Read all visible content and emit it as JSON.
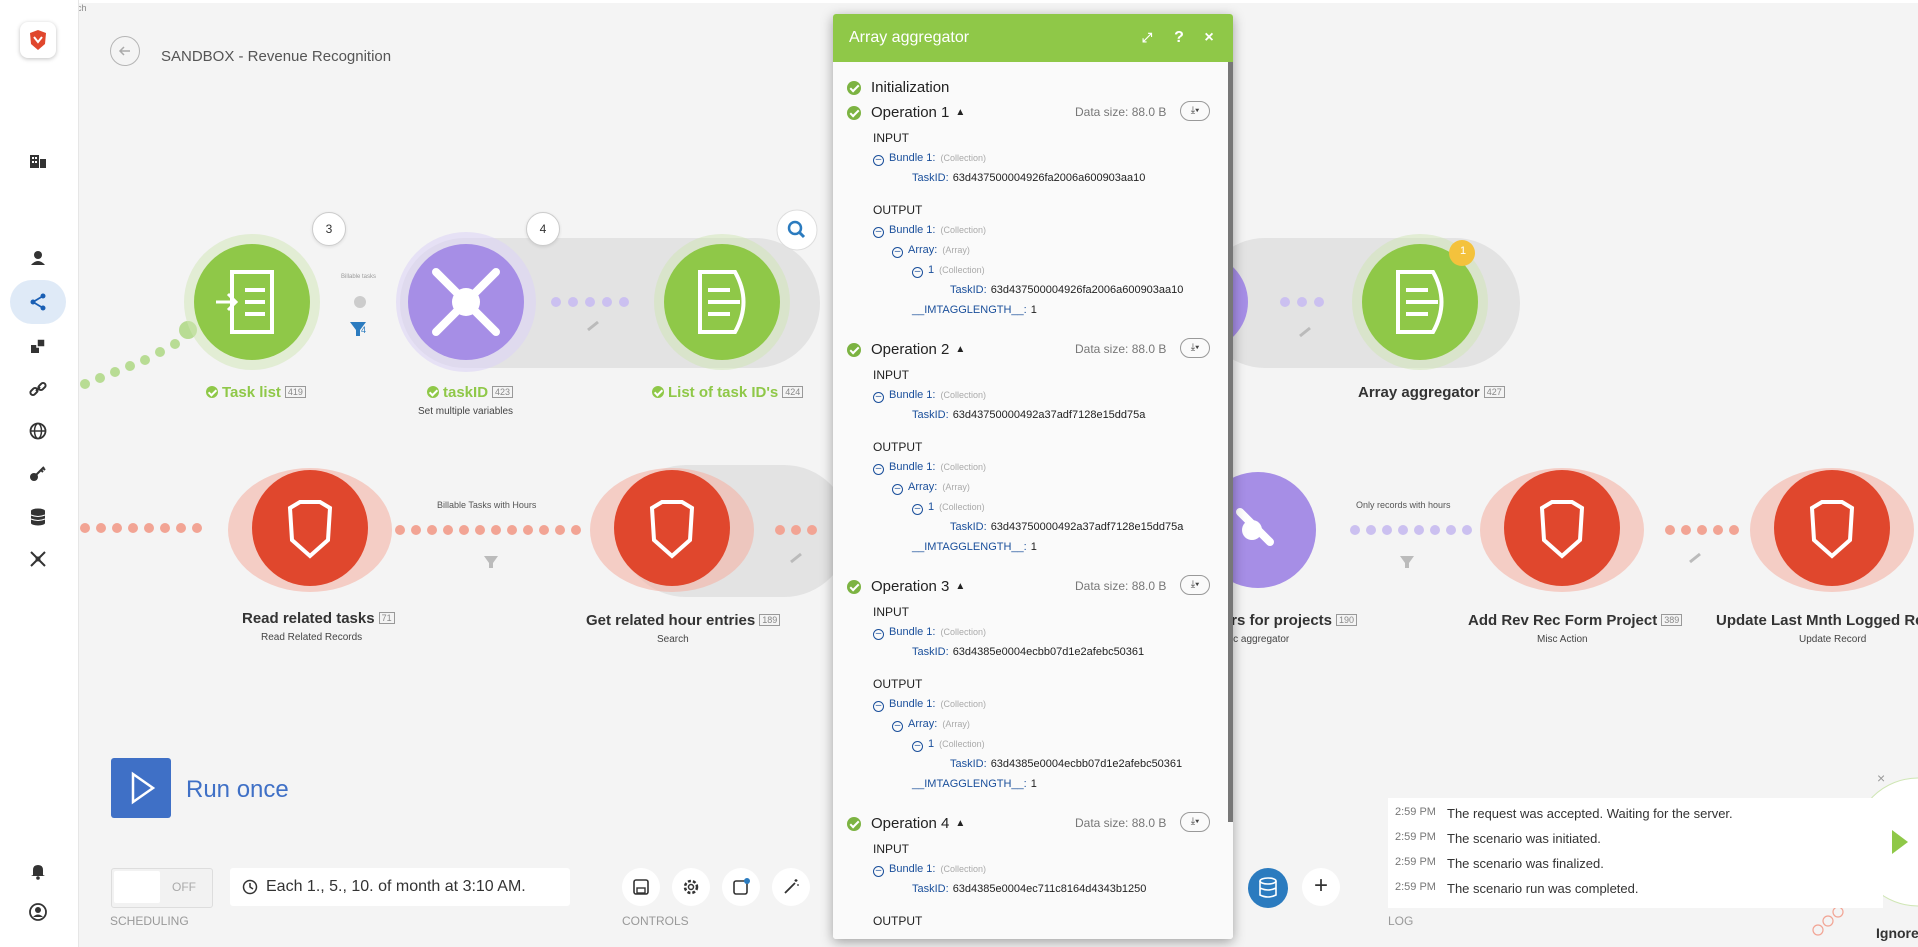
{
  "tiny_top": "ch",
  "header": {
    "title": "SANDBOX - Revenue Recognition"
  },
  "colors": {
    "green": "#8fc848",
    "purple": "#a68ee6",
    "red": "#e0472d",
    "blue": "#3f70c6"
  },
  "sidebar": {
    "icons": [
      "brave-logo-icon",
      "organization-icon",
      "team-icon",
      "scenarios-icon",
      "templates-icon",
      "connections-icon",
      "webhooks-icon",
      "keys-icon",
      "datastores-icon",
      "devices-icon",
      "notifications-icon",
      "profile-icon"
    ]
  },
  "modules": {
    "task_list": {
      "label": "Task list",
      "id": "419"
    },
    "taskid": {
      "label": "taskID",
      "id": "423",
      "sub": "Set multiple variables"
    },
    "list_task_ids": {
      "label": "List of task ID's",
      "id": "424"
    },
    "array_aggregator": {
      "label": "Array aggregator",
      "id": "427",
      "badge": "1"
    },
    "read_related_tasks": {
      "label": "Read related tasks",
      "id": "71",
      "sub": "Read Related Records"
    },
    "get_related_hours": {
      "label": "Get related hour entries",
      "id": "189",
      "sub": "Search"
    },
    "hours_projects": {
      "label": "urs for projects",
      "id": "190",
      "sub": "eric aggregator"
    },
    "add_rev_rec": {
      "label": "Add Rev Rec Form Project",
      "id": "389",
      "sub": "Misc Action"
    },
    "update_last": {
      "label": "Update Last Mnth Logged Rev -",
      "sub": "Update Record"
    }
  },
  "bubbles": {
    "b1": "3",
    "b2": "4"
  },
  "filter_count": "4",
  "routes": {
    "billable": "Billable Tasks with Hours",
    "only_records": "Only records with hours",
    "tiny_filter": "Billable tasks"
  },
  "panel": {
    "title": "Array aggregator",
    "init": "Initialization",
    "operations": [
      {
        "name": "Operation 1",
        "size": "Data size: 88.0 B",
        "in_task": "63d437500004926fa2006a600903aa10",
        "out_task": "63d437500004926fa2006a600903aa10",
        "len": "1"
      },
      {
        "name": "Operation 2",
        "size": "Data size: 88.0 B",
        "in_task": "63d43750000492a37adf7128e15dd75a",
        "out_task": "63d43750000492a37adf7128e15dd75a",
        "len": "1"
      },
      {
        "name": "Operation 3",
        "size": "Data size: 88.0 B",
        "in_task": "63d4385e0004ecbb07d1e2afebc50361",
        "out_task": "63d4385e0004ecbb07d1e2afebc50361",
        "len": "1"
      },
      {
        "name": "Operation 4",
        "size": "Data size: 88.0 B",
        "in_task": "63d4385e0004ec711c8164d4343b1250"
      }
    ],
    "labels": {
      "input": "INPUT",
      "output": "OUTPUT",
      "bundle": "Bundle 1:",
      "collection": "(Collection)",
      "array": "Array:",
      "array_type": "(Array)",
      "one": "1",
      "taskid": "TaskID:",
      "len": "__IMTAGGLENGTH__:"
    }
  },
  "bottom": {
    "run_once": "Run once",
    "toggle": "OFF",
    "schedule": "Each 1., 5., 10. of month at 3:10 AM.",
    "scheduling": "SCHEDULING",
    "controls": "CONTROLS",
    "log_label": "LOG",
    "ignore": "Ignore"
  },
  "log": [
    {
      "time": "2:59 PM",
      "text": "The request was accepted. Waiting for the server."
    },
    {
      "time": "2:59 PM",
      "text": "The scenario was initiated."
    },
    {
      "time": "2:59 PM",
      "text": "The scenario was finalized."
    },
    {
      "time": "2:59 PM",
      "text": "The scenario run was completed."
    }
  ]
}
